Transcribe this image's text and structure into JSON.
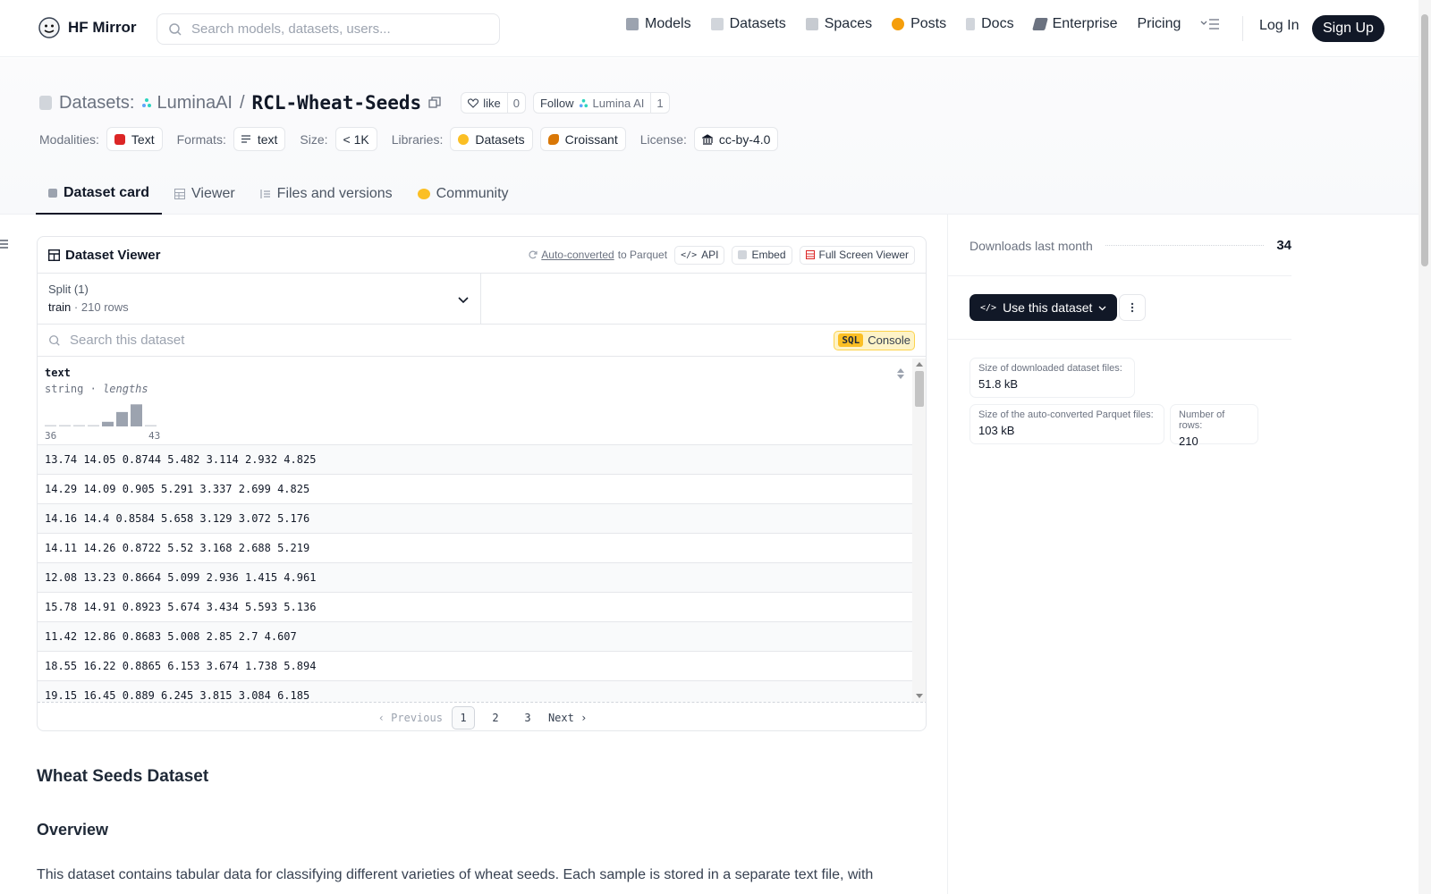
{
  "nav": {
    "brand": "HF Mirror",
    "search_placeholder": "Search models, datasets, users...",
    "links": [
      {
        "label": "Models",
        "icon": "cube-icon",
        "color": "#6b7280"
      },
      {
        "label": "Datasets",
        "icon": "database-icon",
        "color": "#9ca3af"
      },
      {
        "label": "Spaces",
        "icon": "grid-icon",
        "color": "#9ca3af"
      },
      {
        "label": "Posts",
        "icon": "chat-icon",
        "color": "#f59e0b"
      },
      {
        "label": "Docs",
        "icon": "book-icon",
        "color": "#9ca3af"
      },
      {
        "label": "Enterprise",
        "icon": "enterprise-icon",
        "color": "#6b7280"
      },
      {
        "label": "Pricing",
        "icon": "",
        "color": ""
      }
    ],
    "login": "Log In",
    "signup": "Sign Up"
  },
  "header": {
    "prefix": "Datasets:",
    "owner": "LuminaAI",
    "separator": "/",
    "name": "RCL-Wheat-Seeds",
    "like_label": "like",
    "like_count": "0",
    "follow_label": "Follow",
    "follow_org": "Lumina AI",
    "follow_count": "1",
    "tags": {
      "modalities_label": "Modalities:",
      "modality": "Text",
      "formats_label": "Formats:",
      "format": "text",
      "size_label": "Size:",
      "size": "< 1K",
      "libraries_label": "Libraries:",
      "lib1": "Datasets",
      "lib2": "Croissant",
      "license_label": "License:",
      "license": "cc-by-4.0"
    },
    "tabs": [
      "Dataset card",
      "Viewer",
      "Files and versions",
      "Community"
    ]
  },
  "viewer": {
    "title": "Dataset Viewer",
    "auto_converted": "Auto-converted",
    "to_parquet": "to Parquet",
    "api": "API",
    "embed": "Embed",
    "fullscreen": "Full Screen Viewer",
    "split_label": "Split (1)",
    "split_value": "train",
    "split_dot": "·",
    "split_rows": "210 rows",
    "search_placeholder": "Search this dataset",
    "sql": "SQL",
    "console": "Console",
    "column": {
      "name": "text",
      "type": "string",
      "dot": "·",
      "stat": "lengths",
      "min": "36",
      "max": "43",
      "histogram": [
        0.04,
        0.04,
        0.0,
        0.04,
        0.2,
        0.62,
        0.95,
        0.04
      ]
    },
    "rows": [
      "13.74 14.05 0.8744 5.482 3.114 2.932 4.825",
      "14.29 14.09 0.905 5.291 3.337 2.699 4.825",
      "14.16 14.4 0.8584 5.658 3.129 3.072 5.176",
      "14.11 14.26 0.8722 5.52 3.168 2.688 5.219",
      "12.08 13.23 0.8664 5.099 2.936 1.415 4.961",
      "15.78 14.91 0.8923 5.674 3.434 5.593 5.136",
      "11.42 12.86 0.8683 5.008 2.85 2.7 4.607",
      "18.55 16.22 0.8865 6.153 3.674 1.738 5.894",
      "19.15 16.45 0.889 6.245 3.815 3.084 6.185"
    ],
    "pager": {
      "previous": "Previous",
      "pages": [
        "1",
        "2",
        "3"
      ],
      "next": "Next"
    }
  },
  "card": {
    "h2": "Wheat Seeds Dataset",
    "h3": "Overview",
    "paragraph": "This dataset contains tabular data for classifying different varieties of wheat seeds. Each sample is stored in a separate text file, with"
  },
  "sidebar": {
    "downloads_label": "Downloads last month",
    "downloads": "34",
    "use_button": "Use this dataset",
    "stats": [
      {
        "k": "Size of downloaded dataset files:",
        "v": "51.8 kB"
      },
      {
        "k": "Size of the auto-converted Parquet files:",
        "v": "103 kB"
      },
      {
        "k": "Number of rows:",
        "v": "210"
      }
    ]
  }
}
